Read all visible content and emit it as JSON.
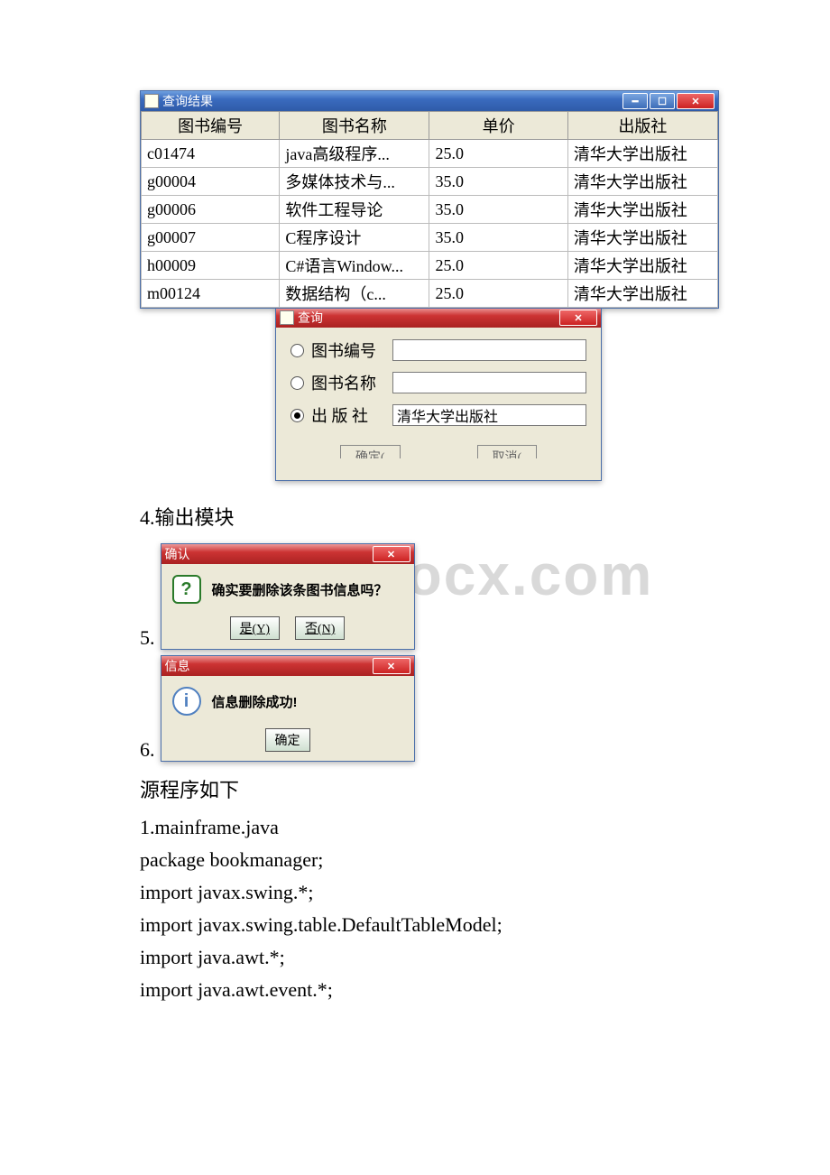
{
  "results_window": {
    "title": "查询结果",
    "columns": [
      "图书编号",
      "图书名称",
      "单价",
      "出版社"
    ],
    "rows": [
      {
        "id": "c01474",
        "name": "java高级程序...",
        "price": "25.0",
        "publisher": "清华大学出版社"
      },
      {
        "id": "g00004",
        "name": "多媒体技术与...",
        "price": "35.0",
        "publisher": "清华大学出版社"
      },
      {
        "id": "g00006",
        "name": "软件工程导论",
        "price": "35.0",
        "publisher": "清华大学出版社"
      },
      {
        "id": "g00007",
        "name": "C程序设计",
        "price": "35.0",
        "publisher": "清华大学出版社"
      },
      {
        "id": "h00009",
        "name": "C#语言Window...",
        "price": "25.0",
        "publisher": "清华大学出版社"
      },
      {
        "id": "m00124",
        "name": "数据结构（c...",
        "price": "25.0",
        "publisher": "清华大学出版社"
      }
    ]
  },
  "query_dialog": {
    "title": "查询",
    "option_id": "图书编号",
    "option_name": "图书名称",
    "option_publisher": "出 版 社",
    "input_id": "",
    "input_name": "",
    "input_publisher": "清华大学出版社",
    "btn_ok_partial": "确定(",
    "btn_cancel_partial": "取消("
  },
  "heading4": "4.输出模块",
  "num5": "5.",
  "num6": "6.",
  "confirm_dialog": {
    "title": "确认",
    "message": "确实要删除该条图书信息吗？",
    "btn_yes": "是(Y)",
    "btn_no": "否(N)"
  },
  "info_dialog": {
    "title": "信息",
    "message": "信息删除成功!",
    "btn_ok": "确定"
  },
  "src_heading": "源程序如下",
  "code": {
    "l1": "1.mainframe.java",
    "l2": "package bookmanager;",
    "l3": "import javax.swing.*;",
    "l4": "import javax.swing.table.DefaultTableModel;",
    "l5": "import java.awt.*;",
    "l6": "import java.awt.event.*;"
  },
  "watermark": "www.bdocx.com"
}
